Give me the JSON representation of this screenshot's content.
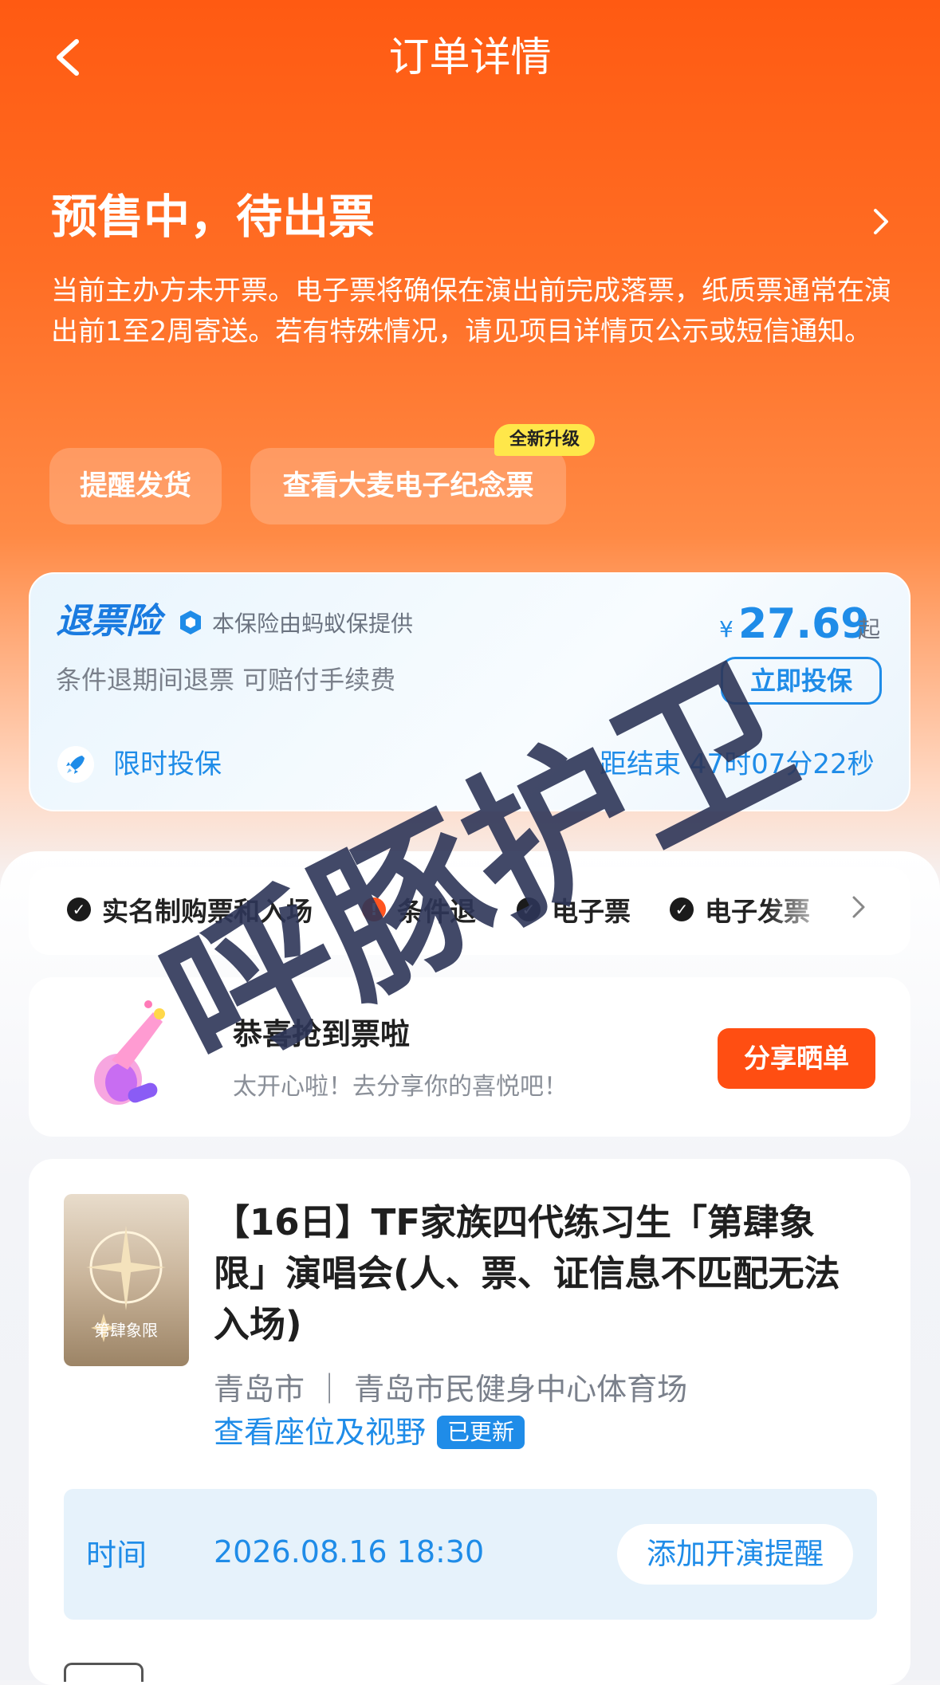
{
  "nav": {
    "title": "订单详情"
  },
  "status": {
    "title": "预售中，待出票",
    "description": "当前主办方未开票。电子票将确保在演出前完成落票，纸质票通常在演出前1至2周寄送。若有特殊情况，请见项目详情页公示或短信通知。"
  },
  "actions": {
    "remind_label": "提醒发货",
    "memorial_label": "查看大麦电子纪念票",
    "new_badge": "全新升级"
  },
  "insurance": {
    "title": "退票险",
    "provider": "本保险由蚂蚁保提供",
    "currency": "¥",
    "price": "27.69",
    "price_suffix": "起",
    "description": "条件退期间退票 可赔付手续费",
    "buy_label": "立即投保",
    "limited_label": "限时投保",
    "countdown": "距结束 47时07分22秒"
  },
  "tags": [
    {
      "label": "实名制购票和入场",
      "icon": "check-icon"
    },
    {
      "label": "条件退",
      "icon": "warning-icon"
    },
    {
      "label": "电子票",
      "icon": "check-icon"
    },
    {
      "label": "电子发票",
      "icon": "check-icon"
    }
  ],
  "share": {
    "title": "恭喜抢到票啦",
    "subtitle": "太开心啦！去分享你的喜悦吧！",
    "button_label": "分享晒单"
  },
  "event": {
    "title": "【16日】TF家族四代练习生「第肆象限」演唱会(人、票、证信息不匹配无法入场)",
    "poster_text": "第肆象限",
    "venue": "青岛市 ｜ 青岛市民健身中心体育场",
    "seat_link": "查看座位及视野",
    "updated_badge": "已更新",
    "time_label": "时间",
    "time_value": "2026.08.16 18:30",
    "add_reminder_label": "添加开演提醒"
  },
  "watermark": {
    "text": "呼豚护卫"
  },
  "colors": {
    "brand_orange": "#ff5a12",
    "insurance_blue": "#1f8ce8",
    "share_button": "#ff4e12",
    "watermark": "#2e3558"
  }
}
